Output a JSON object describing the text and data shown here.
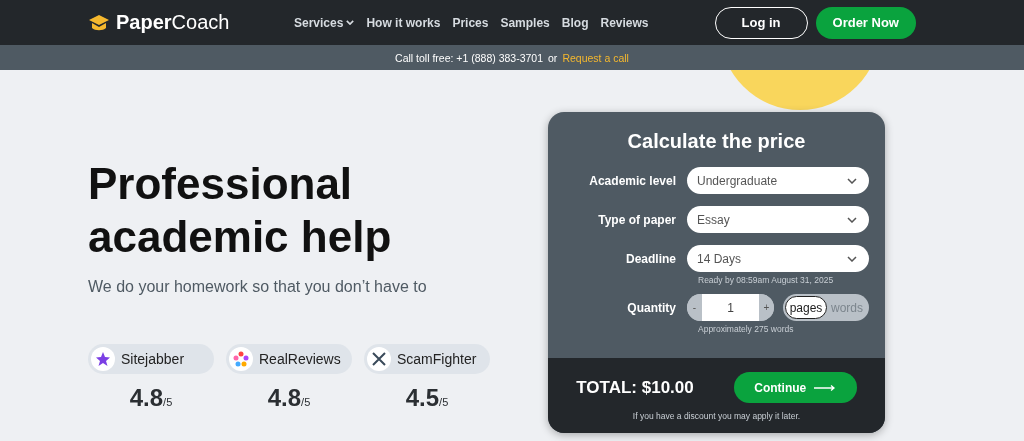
{
  "header": {
    "logo_bold": "Paper",
    "logo_light": "Coach",
    "nav": [
      {
        "label": "Services",
        "dropdown": true
      },
      {
        "label": "How it works",
        "dropdown": false
      },
      {
        "label": "Prices",
        "dropdown": false
      },
      {
        "label": "Samples",
        "dropdown": false
      },
      {
        "label": "Blog",
        "dropdown": false
      },
      {
        "label": "Reviews",
        "dropdown": false
      }
    ],
    "login": "Log in",
    "order": "Order Now"
  },
  "callbar": {
    "text": "Call toll free: +1 (888) 383-3701",
    "or": "or",
    "link": "Request a call"
  },
  "hero": {
    "title": "Professional academic help",
    "subtitle": "We do your homework so that you don’t have to",
    "ratings": [
      {
        "kind": "sitejabber",
        "name": "Sitejabber",
        "score": "4.8",
        "out_of": "/5"
      },
      {
        "kind": "realreviews",
        "name": "RealReviews",
        "score": "4.8",
        "out_of": "/5"
      },
      {
        "kind": "scamfighter",
        "name": "ScamFighter",
        "score": "4.5",
        "out_of": "/5"
      }
    ]
  },
  "calculator": {
    "title": "Calculate the price",
    "fields": [
      {
        "label": "Academic level",
        "value": "Undergraduate"
      },
      {
        "label": "Type of paper",
        "value": "Essay"
      },
      {
        "label": "Deadline",
        "value": "14 Days",
        "note": "Ready by 08:59am August 31, 2025"
      }
    ],
    "quantity": {
      "label": "Quantity",
      "minus": "-",
      "value": "1",
      "plus": "+",
      "units": [
        {
          "label": "pages",
          "selected": true
        },
        {
          "label": "words",
          "selected": false
        }
      ],
      "note": "Approximately 275 words"
    },
    "total": "TOTAL: $10.00",
    "continue": "Continue",
    "discount_note": "If you have a discount you may apply it later."
  }
}
